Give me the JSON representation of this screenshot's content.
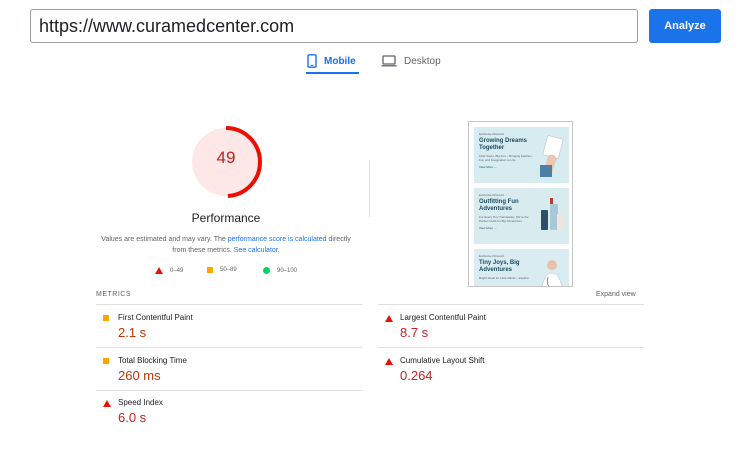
{
  "header": {
    "url_value": "https://www.curamedcenter.com",
    "analyze_label": "Analyze"
  },
  "tabs": [
    {
      "label": "Mobile",
      "icon": "smartphone-icon",
      "active": true
    },
    {
      "label": "Desktop",
      "icon": "laptop-icon",
      "active": false
    }
  ],
  "performance": {
    "score": "49",
    "score_fraction": 0.49,
    "title": "Performance",
    "desc_prefix": "Values are estimated and may vary. The ",
    "desc_link1": "performance score is calculated",
    "desc_mid": " directly from these metrics. ",
    "desc_link2": "See calculator.",
    "legend": [
      {
        "range": "0–49",
        "icon": "fail-triangle-icon"
      },
      {
        "range": "50–89",
        "icon": "average-square-icon"
      },
      {
        "range": "90–100",
        "icon": "pass-circle-icon"
      }
    ]
  },
  "preview": {
    "cards": [
      {
        "badge": "Exclusive Discount",
        "title": "Growing Dreams Together",
        "subtitle": "Little Steps, Big Fun – Bringing Fashion, Fun and Imagination to Life",
        "link": "View More  →"
      },
      {
        "badge": "Exclusive Discount",
        "title": "Outfitting Fun Adventures",
        "subtitle": "For Every Tiny Trendsetter, We're the Perfect Outfit for Big Adventures",
        "link": "View More  →"
      },
      {
        "badge": "Exclusive Discount",
        "title": "Tiny Joys, Big Adventures",
        "subtitle": "Bright Ideas for Little Minds – Explore",
        "link": ""
      }
    ]
  },
  "metrics": {
    "section_label": "METRICS",
    "expand_label": "Expand view",
    "items": [
      {
        "name": "First Contentful Paint",
        "value": "2.1 s",
        "status": "average"
      },
      {
        "name": "Largest Contentful Paint",
        "value": "8.7 s",
        "status": "fail"
      },
      {
        "name": "Total Blocking Time",
        "value": "260 ms",
        "status": "average"
      },
      {
        "name": "Cumulative Layout Shift",
        "value": "0.264",
        "status": "fail"
      },
      {
        "name": "Speed Index",
        "value": "6.0 s",
        "status": "fail"
      }
    ]
  },
  "colors": {
    "accent": "#1a73e8",
    "fail": "#eb0f00",
    "average": "#ffa400",
    "pass": "#0cce6b",
    "gauge_bg": "#fde8e7"
  }
}
